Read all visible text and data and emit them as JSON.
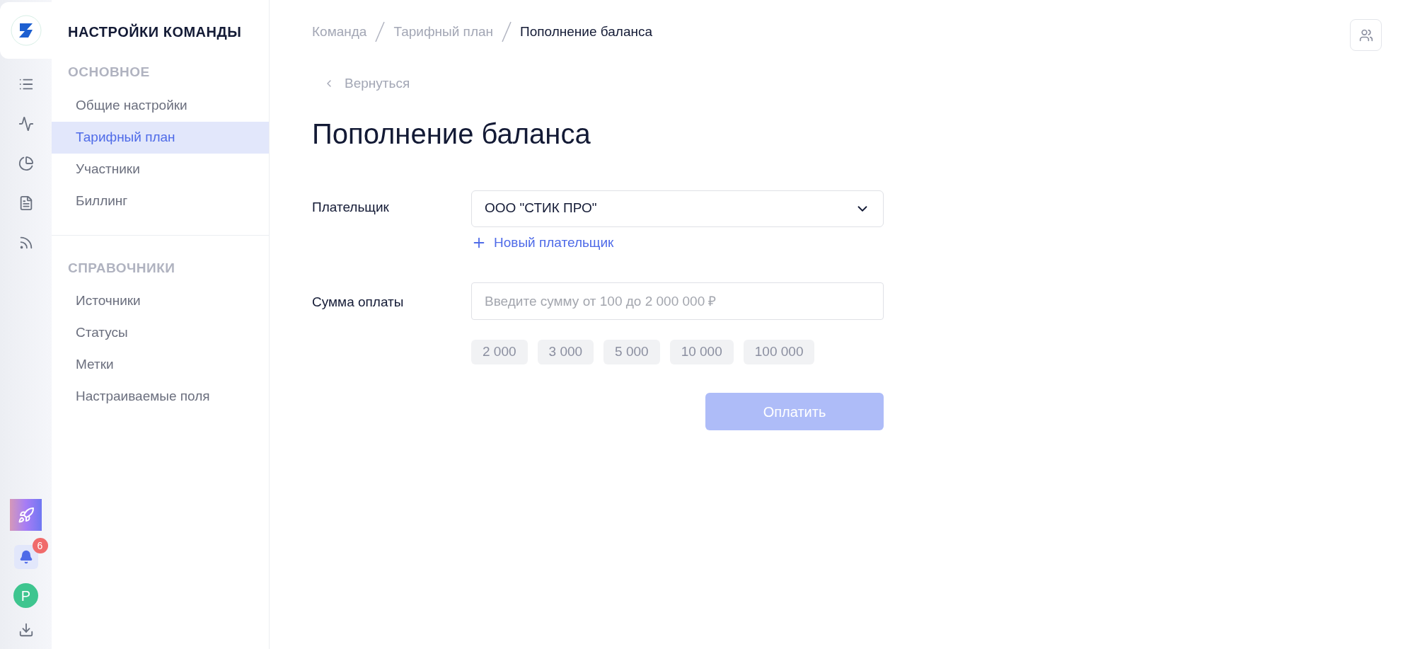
{
  "rail": {
    "avatar_letter": "P",
    "notifications_badge": "6"
  },
  "sidebar": {
    "title": "НАСТРОЙКИ КОМАНДЫ",
    "sections": [
      {
        "header": "ОСНОВНОЕ",
        "items": [
          {
            "label": "Общие настройки",
            "selected": false
          },
          {
            "label": "Тарифный план",
            "selected": true
          },
          {
            "label": "Участники",
            "selected": false
          },
          {
            "label": "Биллинг",
            "selected": false
          }
        ]
      },
      {
        "header": "СПРАВОЧНИКИ",
        "items": [
          {
            "label": "Источники",
            "selected": false
          },
          {
            "label": "Статусы",
            "selected": false
          },
          {
            "label": "Метки",
            "selected": false
          },
          {
            "label": "Настраиваемые поля",
            "selected": false
          }
        ]
      }
    ]
  },
  "breadcrumbs": [
    "Команда",
    "Тарифный план",
    "Пополнение баланса"
  ],
  "back_link": "Вернуться",
  "title": "Пополнение баланса",
  "form": {
    "payer": {
      "label": "Плательщик",
      "value": "ООО \"СТИК ПРО\"",
      "add_link": "Новый плательщик"
    },
    "amount": {
      "label": "Сумма оплаты",
      "placeholder": "Введите сумму от 100 до 2 000 000 ₽",
      "presets": [
        "2 000",
        "3 000",
        "5 000",
        "10 000",
        "100 000"
      ]
    },
    "submit": {
      "label": "Оплатить",
      "disabled": true
    }
  }
}
